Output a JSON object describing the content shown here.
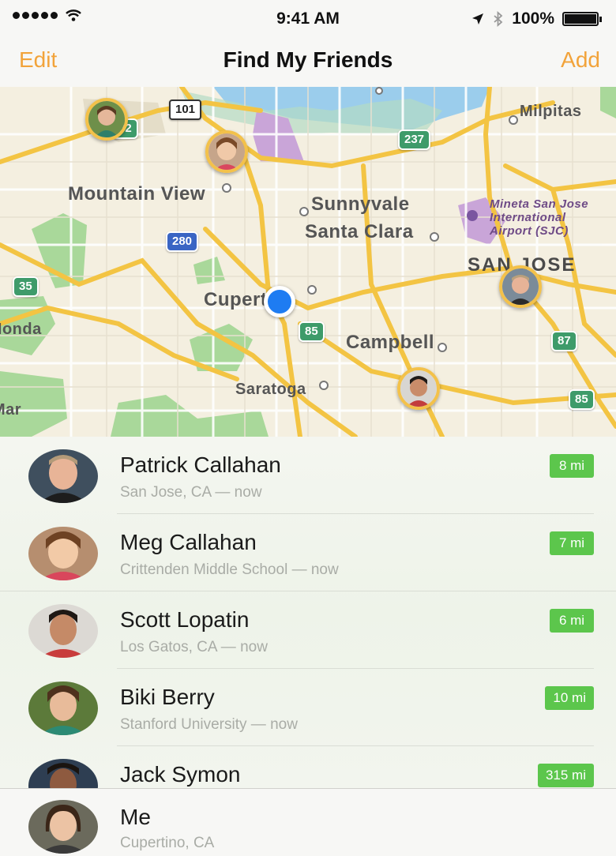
{
  "status_bar": {
    "time": "9:41 AM",
    "battery": "100%",
    "icons": [
      "signal-dots-icon",
      "wifi-icon",
      "location-arrow-icon",
      "bluetooth-icon",
      "battery-icon"
    ]
  },
  "nav": {
    "edit_label": "Edit",
    "title": "Find My Friends",
    "add_label": "Add",
    "accent_color": "#f2a33a"
  },
  "map": {
    "labels": {
      "mountain_view": "Mountain View",
      "sunnyvale": "Sunnyvale",
      "santa_clara": "Santa Clara",
      "san_jose": "SAN JOSE",
      "cupertino": "Cupertino",
      "campbell": "Campbell",
      "saratoga": "Saratoga",
      "milpitas": "Milpitas",
      "honda": "Honda",
      "mar": "Mar",
      "airport_line1": "Mineta San Jose",
      "airport_line2": "International",
      "airport_line3": "Airport (SJC)"
    },
    "highways": {
      "h101": "101",
      "h237": "237",
      "h280": "280",
      "h85a": "85",
      "h85b": "85",
      "h87": "87",
      "h35": "35",
      "h82": "82"
    }
  },
  "friends": [
    {
      "name": "Patrick Callahan",
      "location": "San Jose, CA — now",
      "distance": "8 mi"
    },
    {
      "name": "Meg Callahan",
      "location": "Crittenden Middle School — now",
      "distance": "7 mi"
    },
    {
      "name": "Scott Lopatin",
      "location": "Los Gatos, CA — now",
      "distance": "6 mi"
    },
    {
      "name": "Biki Berry",
      "location": "Stanford University — now",
      "distance": "10 mi"
    },
    {
      "name": "Jack Symon",
      "location": "",
      "distance": "315 mi"
    }
  ],
  "me": {
    "name": "Me",
    "location": "Cupertino, CA"
  },
  "colors": {
    "distance_badge": "#5cc64c",
    "user_location": "#1e7cf2",
    "pin_border": "#f3c14a"
  }
}
